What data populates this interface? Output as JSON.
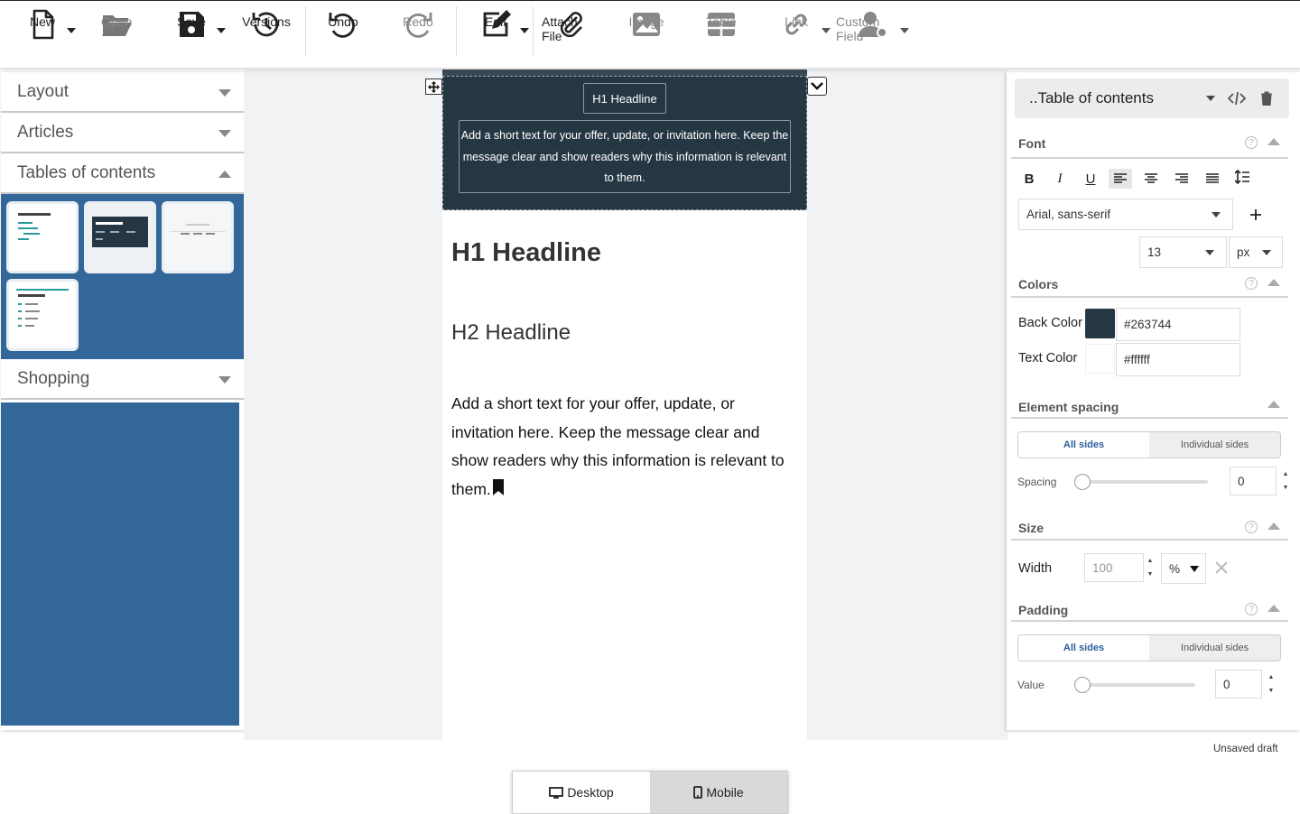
{
  "toolbar": {
    "new": "New",
    "open": "Open",
    "save": "Save",
    "versions": "Versions",
    "undo": "Undo",
    "redo": "Redo",
    "edit": "Edit",
    "attach_file": "Attach File",
    "image": "Image",
    "table": "Table",
    "link": "Link",
    "custom_field": "Custom Field"
  },
  "sidebar": {
    "sections": [
      {
        "label": "Layout",
        "expanded": false
      },
      {
        "label": "Articles",
        "expanded": false
      },
      {
        "label": "Tables of contents",
        "expanded": true
      },
      {
        "label": "Shopping",
        "expanded": false
      }
    ]
  },
  "canvas": {
    "block_headline": "H1 Headline",
    "block_text": "Add a short text for your offer, update, or invitation here. Keep the message clear and show readers why this information is relevant to them.",
    "h1": "H1 Headline",
    "h2": "H2 Headline",
    "paragraph": "Add a short text for your offer, update, or invitation here. Keep the message clear and show readers why this information is relevant to them."
  },
  "props": {
    "element_select": "..Table of contents",
    "font": {
      "title": "Font",
      "family": "Arial, sans-serif",
      "size": "13",
      "unit": "px"
    },
    "colors": {
      "title": "Colors",
      "back_label": "Back Color",
      "back_value": "#263744",
      "text_label": "Text Color",
      "text_value": "#ffffff"
    },
    "spacing": {
      "title": "Element spacing",
      "all_sides": "All sides",
      "individual": "Individual sides",
      "label": "Spacing",
      "value": "0"
    },
    "size": {
      "title": "Size",
      "width_label": "Width",
      "width_value": "100",
      "unit": "%"
    },
    "padding": {
      "title": "Padding",
      "all_sides": "All sides",
      "individual": "Individual sides",
      "label": "Value",
      "value": "0"
    }
  },
  "status": "Unsaved draft",
  "device": {
    "desktop": "Desktop",
    "mobile": "Mobile"
  },
  "colors": {
    "accent_blue": "#336699",
    "dark_block": "#263744"
  }
}
